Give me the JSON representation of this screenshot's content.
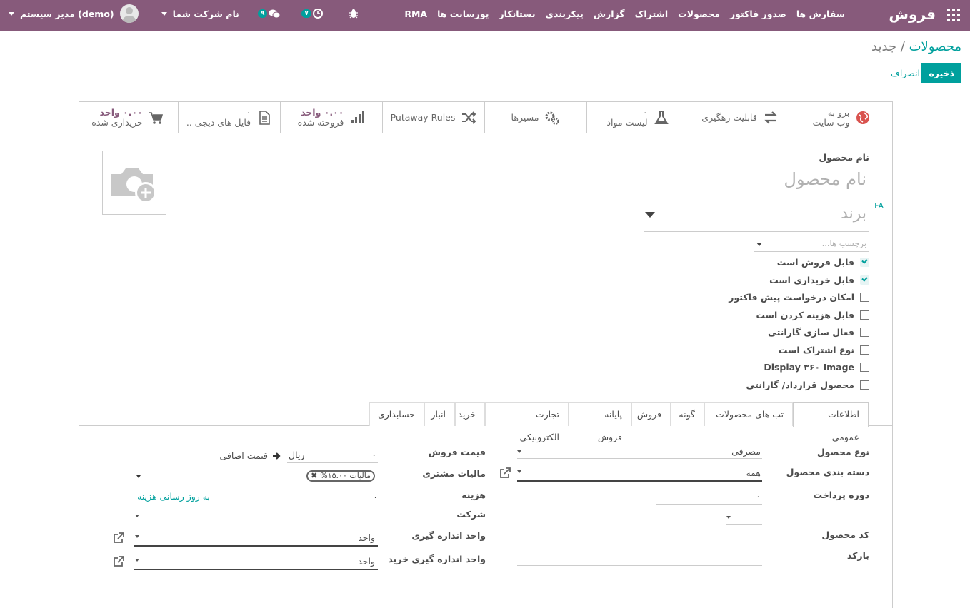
{
  "topbar": {
    "brand": "فروش",
    "menu": [
      "سفارش ها",
      "صدور فاکتور",
      "محصولات",
      "اشتراک",
      "گزارش",
      "پیکربندی",
      "بستانکار",
      "پورسانت ها",
      "RMA"
    ],
    "user": "مدیر سیستم (demo)",
    "company": "نام شرکت شما",
    "messages_badge": "۹",
    "activity_badge": "۷"
  },
  "breadcrumb": {
    "parent": "محصولات",
    "sep": "/",
    "current": "جدید"
  },
  "actions": {
    "save": "ذخیره",
    "discard": "انصراف"
  },
  "stats": {
    "website": [
      "برو به",
      "وب سایت"
    ],
    "traceability": "قابلیت رهگیری",
    "bom_count": "۰",
    "bom_label": "لیست مواد",
    "routes": "مسیرها",
    "putaway": "Putaway Rules",
    "sold_num": "۰.۰۰ واحد",
    "sold_label": "فروخته شده",
    "digital_num": "۰",
    "digital_label": "فایل های دیجی ..",
    "purchased_num": "۰.۰۰ واحد",
    "purchased_label": "خریداری شده"
  },
  "form": {
    "name_label": "نام محصول",
    "name_placeholder": "نام محصول",
    "lang": "FA",
    "brand_placeholder": "برند",
    "tags_placeholder": "برچسب ها...",
    "checks": [
      {
        "label": "قابل فروش است",
        "checked": true
      },
      {
        "label": "قابل خریداری است",
        "checked": true
      },
      {
        "label": "امکان درخواست پیش فاکتور",
        "checked": false
      },
      {
        "label": "قابل هزینه کردن است",
        "checked": false
      },
      {
        "label": "فعال سازی گارانتی",
        "checked": false
      },
      {
        "label": "نوع اشتراک است",
        "checked": false
      },
      {
        "label": "Display ۳۶۰ Image",
        "checked": false
      },
      {
        "label": "محصول قرارداد/ گارانتی",
        "checked": false
      }
    ]
  },
  "tabs": [
    "اطلاعات عمومی",
    "تب های محصولات",
    "گونه",
    "فروش",
    "پایانه فروش",
    "تجارت الکترونیکی",
    "خرید",
    "انبار",
    "حسابداری"
  ],
  "general": {
    "type_label": "نوع محصول",
    "type_value": "مصرفی",
    "categ_label": "دسته بندی محصول",
    "categ_value": "همه",
    "period_label": "دوره پرداخت",
    "period_value": "۰",
    "code_label": "کد محصول",
    "barcode_label": "بارکد",
    "price_label": "قیمت فروش",
    "price_value": "۰",
    "currency": "ریال",
    "extra_price": "قیمت اضافی",
    "tax_label": "مالیات مشتری",
    "tax_tag": "مالیات ۱۵.۰۰%",
    "cost_label": "هزینه",
    "cost_value": "۰",
    "update_cost": "به روز رسانی هزینه",
    "company_label": "شرکت",
    "uom_label": "واحد اندازه گیری",
    "uom_value": "واحد",
    "po_uom_label": "واحد اندازه گیری خرید",
    "po_uom_value": "واحد"
  }
}
